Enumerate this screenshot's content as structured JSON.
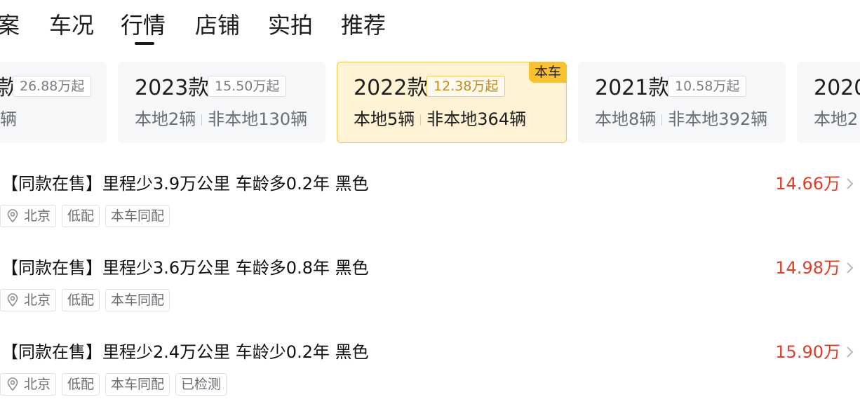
{
  "tabs": [
    {
      "label": "案"
    },
    {
      "label": "车况"
    },
    {
      "label": "行情",
      "active": true
    },
    {
      "label": "店铺"
    },
    {
      "label": "实拍"
    },
    {
      "label": "推荐"
    }
  ],
  "year_cards": [
    {
      "year": "款",
      "price": "26.88万起",
      "counts_text": "辆"
    },
    {
      "year": "2023款",
      "price": "15.50万起",
      "local": "本地2辆",
      "nonlocal": "非本地130辆"
    },
    {
      "year": "2022款",
      "price": "12.38万起",
      "local": "本地5辆",
      "nonlocal": "非本地364辆",
      "badge": "本车",
      "selected": true
    },
    {
      "year": "2021款",
      "price": "10.58万起",
      "local": "本地8辆",
      "nonlocal": "非本地392辆"
    },
    {
      "year": "2020",
      "counts_text": "本地2"
    }
  ],
  "listings": [
    {
      "title": "【同款在售】里程少3.9万公里 车龄多0.2年 黑色",
      "price": "14.66万",
      "tags": [
        "北京",
        "低配",
        "本车同配"
      ]
    },
    {
      "title": "【同款在售】里程少3.6万公里 车龄多0.8年 黑色",
      "price": "14.98万",
      "tags": [
        "北京",
        "低配",
        "本车同配"
      ]
    },
    {
      "title": "【同款在售】里程少2.4万公里 车龄少0.2年 黑色",
      "price": "15.90万",
      "tags": [
        "北京",
        "低配",
        "本车同配",
        "已检测"
      ]
    }
  ],
  "icons": {
    "location": "location-pin-icon",
    "chevron": "chevron-right-icon"
  },
  "colors": {
    "price": "#e23c24",
    "badge": "#f9c22e",
    "selected_bg": "#fff3d6"
  }
}
